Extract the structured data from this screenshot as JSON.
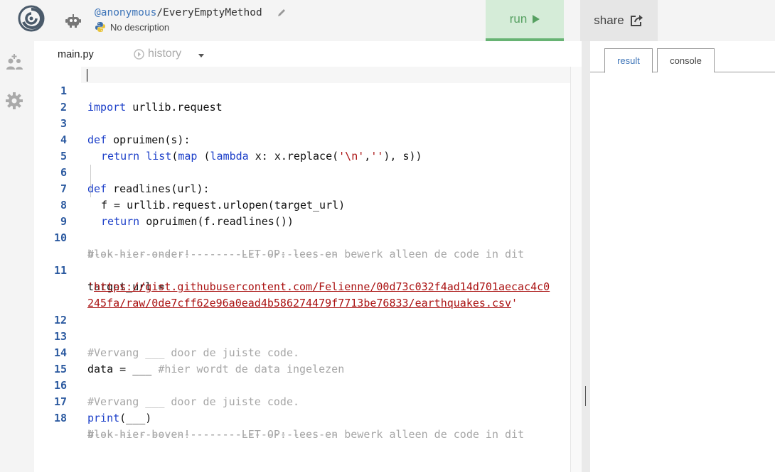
{
  "header": {
    "owner": "@anonymous",
    "separator": "/",
    "repl_name": "EveryEmptyMethod",
    "description": "No description",
    "run_label": "run",
    "share_label": "share"
  },
  "icons": {
    "logo": "repl-logo-icon",
    "avatar": "robot-avatar-icon",
    "edit": "pencil-icon",
    "language": "python-icon",
    "run": "play-icon",
    "share": "share-icon",
    "sidebar_1": "add-user-icon",
    "sidebar_2": "gear-icon",
    "history": "history-icon"
  },
  "editor": {
    "file_tab": "main.py",
    "history_tab": "history"
  },
  "output": {
    "tab_result": "result",
    "tab_console": "console"
  },
  "code_lines": {
    "n1": "1",
    "n2": "2",
    "n3": "3",
    "n4": "4",
    "n5": "5",
    "n6": "6",
    "n7": "7",
    "n8": "8",
    "n9": "9",
    "n10": "10",
    "n11": "11",
    "n12": "12",
    "n13": "13",
    "n14": "14",
    "n15": "15",
    "n16": "16",
    "n17": "17",
    "n18": "18",
    "l1_kw": "import",
    "l1_rest": " urllib.request",
    "l3_kw": "def",
    "l3_rest": " opruimen(s):",
    "l4_kw1": "return",
    "l4_a": " ",
    "l4_fn1": "list",
    "l4_b": "(",
    "l4_fn2": "map",
    "l4_c": " (",
    "l4_kw2": "lambda",
    "l4_d": " x: x.replace(",
    "l4_s1": "'\\n'",
    "l4_e": ",",
    "l4_s2": "''",
    "l4_f": "), s))",
    "l6_kw": "def",
    "l6_rest": " readlines(url):",
    "l7": "f = urllib.request.urlopen(target_url)",
    "l8_kw": "return",
    "l8_rest": " opruimen(f.readlines())",
    "l10a": "#-----------------------LET OP: lees en bewerk alleen de code in dit",
    "l10b": "blok hier onder!-----------------------",
    "l11a": "target_url =",
    "l11_q1": "'",
    "l11_url1": "https://gist.githubusercontent.com/Felienne/00d73c032f4ad14d701aecac4c0",
    "l11_url2": "245fa/raw/0de7cff62e96a0ead4b586274479f7713be76833/earthquakes.csv",
    "l11_q2": "'",
    "l13": "#Vervang ___ door de juiste code.",
    "l14_code": "data = ___ ",
    "l14_cmt": "#hier wordt de data ingelezen",
    "l16": "#Vervang ___ door de juiste code.",
    "l17_fn": "print",
    "l17_rest": "(___)",
    "l18a": "#-----------------------LET OP: lees en bewerk alleen de code in dit",
    "l18b": "blok hier boven!-----------------------"
  },
  "colors": {
    "run_bg": "#d5ecd8",
    "run_accent": "#56a061",
    "keyword": "#1d40c9",
    "string": "#aa1111",
    "comment": "#a6a6a6",
    "line_number": "#2c5aa0"
  }
}
